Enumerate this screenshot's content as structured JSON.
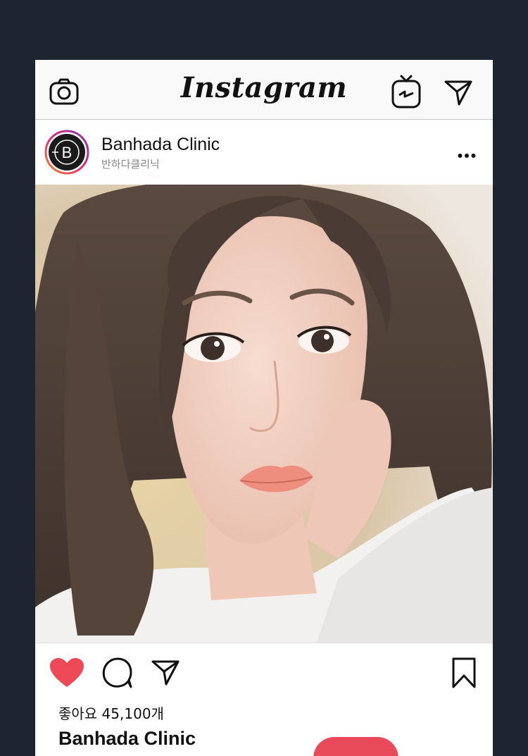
{
  "topbar": {
    "logo": "Instagram",
    "icons": [
      "camera-icon",
      "igtv-icon",
      "direct-message-icon"
    ]
  },
  "post": {
    "account_name": "Banhada Clinic",
    "account_subtitle": "반하다클리닉",
    "avatar_letter": "B",
    "image_alt": "Selfie of a woman with long brown hair in a white top",
    "liked": true,
    "likes_text": "좋아요 45,100개",
    "caption_name": "Banhada Clinic"
  },
  "colors": {
    "background": "#1e2530",
    "heart": "#ed4956",
    "accent_pill": "#e94a5a",
    "avatar_ring_start": "#f58529",
    "avatar_ring_end": "#8134af"
  }
}
